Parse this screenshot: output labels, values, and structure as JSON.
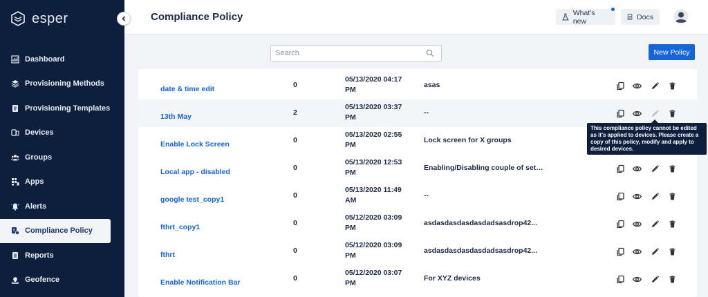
{
  "brand": {
    "name": "esper"
  },
  "sidebar": {
    "items": [
      {
        "label": "Dashboard",
        "icon": "dashboard-icon",
        "active": false
      },
      {
        "label": "Provisioning Methods",
        "icon": "layers-icon",
        "active": false
      },
      {
        "label": "Provisioning Templates",
        "icon": "template-icon",
        "active": false
      },
      {
        "label": "Devices",
        "icon": "devices-icon",
        "active": false
      },
      {
        "label": "Groups",
        "icon": "groups-icon",
        "active": false
      },
      {
        "label": "Apps",
        "icon": "apps-icon",
        "active": false
      },
      {
        "label": "Alerts",
        "icon": "bell-icon",
        "active": false
      },
      {
        "label": "Compliance Policy",
        "icon": "compliance-icon",
        "active": true
      },
      {
        "label": "Reports",
        "icon": "reports-icon",
        "active": false
      },
      {
        "label": "Geofence",
        "icon": "geofence-icon",
        "active": false
      }
    ]
  },
  "header": {
    "title": "Compliance Policy",
    "whats_new": "What's new",
    "docs": "Docs"
  },
  "toolbar": {
    "search_placeholder": "Search",
    "new_policy": "New Policy"
  },
  "policies": [
    {
      "name": "date & time edit",
      "count": "0",
      "date": "05/13/2020 04:17 PM",
      "description": "asas",
      "edit_disabled": false
    },
    {
      "name": "13th May",
      "count": "2",
      "date": "05/13/2020 03:37 PM",
      "description": "--",
      "edit_disabled": true
    },
    {
      "name": "Enable Lock Screen",
      "count": "0",
      "date": "05/13/2020 02:55 PM",
      "description": "Lock screen for X groups",
      "edit_disabled": false
    },
    {
      "name": "Local app - disabled",
      "count": "0",
      "date": "05/13/2020 12:53 PM",
      "description": "Enabling/Disabling couple of settin...",
      "edit_disabled": false
    },
    {
      "name": "google test_copy1",
      "count": "0",
      "date": "05/13/2020 11:49 AM",
      "description": "--",
      "edit_disabled": false
    },
    {
      "name": "fthrt_copy1",
      "count": "0",
      "date": "05/12/2020 03:09 PM",
      "description": "asdasdasdasdasdadsasdrop42...",
      "edit_disabled": false
    },
    {
      "name": "fthrt",
      "count": "0",
      "date": "05/12/2020 03:09 PM",
      "description": "asdasdasdasdasdadsasdrop42...",
      "edit_disabled": false
    },
    {
      "name": "Enable Notification Bar",
      "count": "0",
      "date": "05/12/2020 03:07 PM",
      "description": "For XYZ devices",
      "edit_disabled": false
    }
  ],
  "tooltip": {
    "text": "This compliance policy cannot be edited as it's applied to devices. Please create a copy of this policy, modify and apply to desired devices."
  },
  "colors": {
    "sidebar_bg": "#0e1f3d",
    "accent": "#1565d8",
    "row_highlight": "#f4f5f7"
  }
}
